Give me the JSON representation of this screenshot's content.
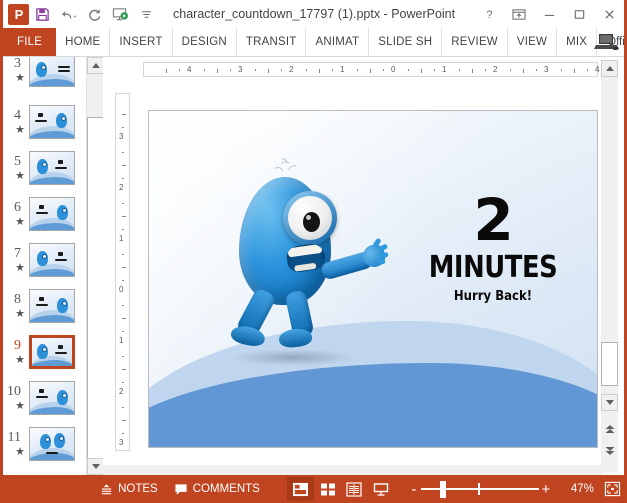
{
  "window": {
    "title": "character_countdown_17797 (1).pptx - PowerPoint",
    "app_icon": "powerpoint-icon",
    "quick_access": [
      {
        "name": "save-icon",
        "label": "Save"
      },
      {
        "name": "undo-icon",
        "label": "Undo"
      },
      {
        "name": "redo-icon",
        "label": "Redo"
      },
      {
        "name": "start-slideshow-icon",
        "label": "Start From Beginning"
      },
      {
        "name": "customize-qat-icon",
        "label": "Customize Quick Access Toolbar"
      }
    ],
    "controls": [
      {
        "name": "help-button",
        "glyph": "?"
      },
      {
        "name": "ribbon-display-options-button",
        "glyph": "ribbon"
      },
      {
        "name": "minimize-button",
        "glyph": "minimize"
      },
      {
        "name": "maximize-button",
        "glyph": "maximize"
      },
      {
        "name": "close-button",
        "glyph": "close"
      }
    ]
  },
  "ribbon": {
    "tabs": [
      {
        "label": "FILE",
        "active_file": true
      },
      {
        "label": "HOME"
      },
      {
        "label": "INSERT"
      },
      {
        "label": "DESIGN"
      },
      {
        "label": "TRANSIT"
      },
      {
        "label": "ANIMAT"
      },
      {
        "label": "SLIDE SH"
      },
      {
        "label": "REVIEW"
      },
      {
        "label": "VIEW"
      },
      {
        "label": "MIX"
      }
    ],
    "account": "Office Tut...",
    "account_caret": "▾"
  },
  "thumbnails": {
    "slides": [
      {
        "number": "3",
        "animated": true,
        "selected": false,
        "layout": "right"
      },
      {
        "number": "4",
        "animated": true,
        "selected": false,
        "layout": "left"
      },
      {
        "number": "5",
        "animated": true,
        "selected": false,
        "layout": "right"
      },
      {
        "number": "6",
        "animated": true,
        "selected": false,
        "layout": "left"
      },
      {
        "number": "7",
        "animated": true,
        "selected": false,
        "layout": "right"
      },
      {
        "number": "8",
        "animated": true,
        "selected": false,
        "layout": "left"
      },
      {
        "number": "9",
        "animated": true,
        "selected": true,
        "layout": "right"
      },
      {
        "number": "10",
        "animated": true,
        "selected": false,
        "layout": "left"
      },
      {
        "number": "11",
        "animated": true,
        "selected": false,
        "layout": "pair"
      }
    ],
    "star_glyph": "★"
  },
  "rulers": {
    "horizontal_ticks": [
      "4",
      "3",
      "2",
      "1",
      "0",
      "1",
      "2",
      "3",
      "4"
    ],
    "vertical_ticks": [
      "3",
      "2",
      "1",
      "0",
      "1",
      "2",
      "3"
    ]
  },
  "slide": {
    "countdown_number": "2",
    "countdown_unit": "MINUTES",
    "subtitle": "Hurry Back!",
    "character": "blue-one-eyed-monster",
    "colors": {
      "sky_top": "#fdfefe",
      "sky_bottom": "#cfe0f2",
      "wave_back": "#bfd6ee",
      "wave_front": "#6197d4",
      "monster_blue": "#2a93dd",
      "text": "#0a0a0a"
    }
  },
  "statusbar": {
    "notes_label": "NOTES",
    "comments_label": "COMMENTS",
    "views": [
      {
        "name": "normal-view-button",
        "active": true
      },
      {
        "name": "slide-sorter-view-button",
        "active": false
      },
      {
        "name": "reading-view-button",
        "active": false
      },
      {
        "name": "slide-show-button",
        "active": false
      }
    ],
    "zoom_out": "-",
    "zoom_in": "+",
    "zoom_level": "47%",
    "fit_slide_label": "Fit slide to current window",
    "accent_color": "#c0441f"
  }
}
